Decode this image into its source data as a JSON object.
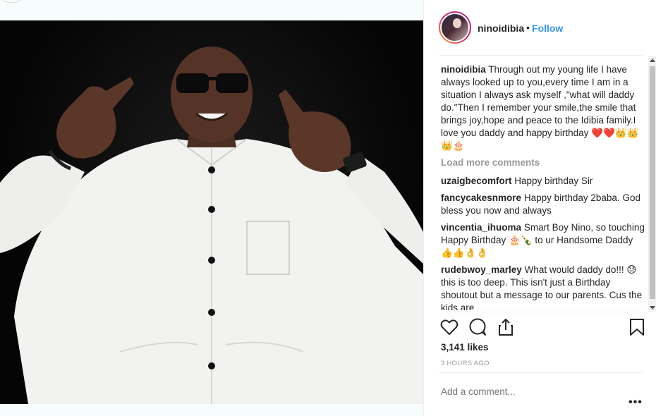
{
  "post": {
    "username": "ninoidibia",
    "separator": "•",
    "follow_label": "Follow"
  },
  "comments": {
    "caption": {
      "user": "ninoidibia",
      "text": "Through out my young life I have always looked up to you,every time I am in a situation I always ask myself ,\"what will daddy do.\"Then I remember your smile,the smile that brings joy,hope and peace to the Idibia family.I love you daddy and happy birthday ❤️❤️👑👑👑🎂"
    },
    "load_more": "Load more comments",
    "items": [
      {
        "user": "uzaigbecomfort",
        "text": "Happy birthday Sir"
      },
      {
        "user": "fancycakesnmore",
        "text": "Happy birthday 2baba. God bless you now and always"
      },
      {
        "user": "vincentia_ihuoma",
        "text": "Smart Boy Nino, so touching Happy Birthday 🎂🍾 to ur Handsome Daddy 👍👍👌👌"
      },
      {
        "user": "rudebwoy_marley",
        "text": "What would daddy do!!! 😓this is too deep. This isn't just a Birthday shoutout but a message to our parents. Cus the kids are"
      }
    ]
  },
  "actions": {
    "like_icon": "heart-outline-icon",
    "comment_icon": "speech-bubble-icon",
    "share_icon": "share-arrow-icon",
    "save_icon": "bookmark-icon"
  },
  "likes": "3,141 likes",
  "timestamp": "3 HOURS AGO",
  "add_comment": {
    "placeholder": "Add a comment..."
  },
  "more_label": "•••",
  "colors": {
    "accent": "#3897f0",
    "muted": "#999999",
    "text": "#262626"
  }
}
